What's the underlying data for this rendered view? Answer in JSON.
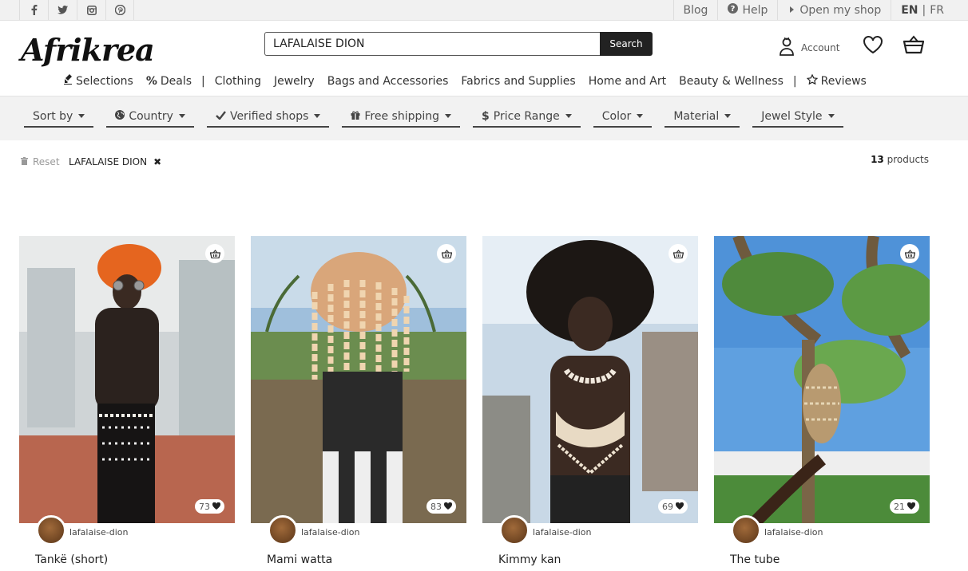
{
  "topbar": {
    "social": [
      "facebook-icon",
      "twitter-icon",
      "instagram-icon",
      "pinterest-icon"
    ],
    "blog": "Blog",
    "help": "Help",
    "open_shop": "Open my shop",
    "lang_en": "EN",
    "lang_sep": "|",
    "lang_fr": "FR"
  },
  "header": {
    "logo": "Afrikrea",
    "search_value": "LAFALAISE DION",
    "search_button": "Search",
    "account": "Account"
  },
  "nav": {
    "selections": "Selections",
    "deals": "Deals",
    "sep": "|",
    "clothing": "Clothing",
    "jewelry": "Jewelry",
    "bags": "Bags and Accessories",
    "fabrics": "Fabrics and Supplies",
    "home": "Home and Art",
    "beauty": "Beauty & Wellness",
    "reviews": "Reviews"
  },
  "filters": [
    "Sort by",
    "Country",
    "Verified shops",
    "Free shipping",
    "Price Range",
    "Color",
    "Material",
    "Jewel Style"
  ],
  "results": {
    "reset": "Reset",
    "tag": "LAFALAISE DION",
    "count": "13",
    "count_label": "products"
  },
  "products": [
    {
      "name": "Tankë (short)",
      "shop": "lafalaise-dion",
      "likes": "73"
    },
    {
      "name": "Mami watta",
      "shop": "lafalaise-dion",
      "likes": "83"
    },
    {
      "name": "Kimmy kan",
      "shop": "lafalaise-dion",
      "likes": "69"
    },
    {
      "name": "The tube",
      "shop": "lafalaise-dion",
      "likes": "21"
    }
  ],
  "colors": {
    "dark": "#222222",
    "filterbar": "#f2f2f2",
    "topbar": "#f1f1f1"
  }
}
